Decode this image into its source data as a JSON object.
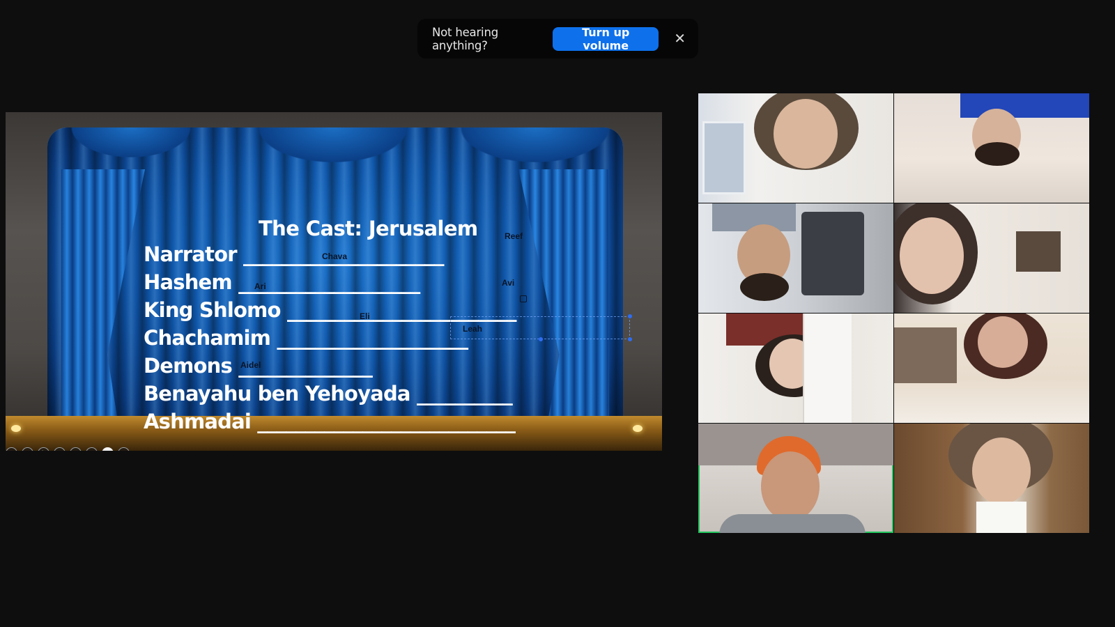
{
  "toast": {
    "message": "Not hearing anything?",
    "button_label": "Turn up volume",
    "close_glyph": "✕"
  },
  "slide": {
    "title": "The Cast: Jerusalem",
    "roles": [
      {
        "label": "Narrator _____________________"
      },
      {
        "label": "Hashem ___________________"
      },
      {
        "label": "King Shlomo ________________________"
      },
      {
        "label": "Chachamim ____________________"
      },
      {
        "label": "Demons ______________"
      },
      {
        "label": "Benayahu ben Yehoyada __________"
      },
      {
        "label": "Ashmadai ___________________________"
      }
    ],
    "name_tags": {
      "reef": "Reef",
      "chava": "Chava",
      "avi": "Avi",
      "ari": "Ari",
      "eli": "Eli",
      "leah": "Leah",
      "aidel": "Aidel"
    },
    "toolbar_icons": [
      "prev-icon",
      "next-icon",
      "pen-icon",
      "slides-icon",
      "zoom-icon",
      "subtitles-icon",
      "camera-icon",
      "more-icon"
    ],
    "toolbar_glyphs": {
      "prev": "◀",
      "next": "▶",
      "pen": "✎",
      "slides": "▤",
      "zoom": "⌕",
      "subtitles": "▭",
      "camera": "▣",
      "more": "…"
    }
  },
  "gallery": {
    "active_border_color": "#22c55e",
    "tiles": 8
  },
  "colors": {
    "background": "#0e0e0f",
    "accent": "#0e71eb"
  }
}
